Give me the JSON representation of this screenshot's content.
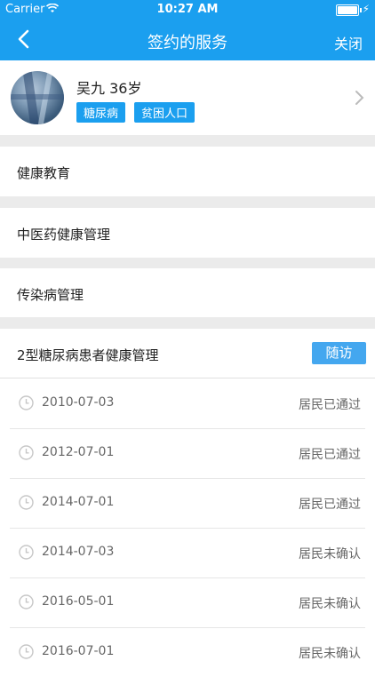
{
  "status_bar": {
    "carrier": "Carrier",
    "time": "10:27 AM"
  },
  "nav": {
    "title": "签约的服务",
    "close_label": "关闭"
  },
  "profile": {
    "name_age": "吴九 36岁",
    "tags": [
      "糖尿病",
      "贫困人口"
    ]
  },
  "menu": [
    "健康教育",
    "中医药健康管理",
    "传染病管理"
  ],
  "diabetes_section": {
    "title": "2型糖尿病患者健康管理",
    "follow_up_label": "随访"
  },
  "records": [
    {
      "date": "2010-07-03",
      "status": "居民已通过"
    },
    {
      "date": "2012-07-01",
      "status": "居民已通过"
    },
    {
      "date": "2014-07-01",
      "status": "居民已通过"
    },
    {
      "date": "2014-07-03",
      "status": "居民未确认"
    },
    {
      "date": "2016-05-01",
      "status": "居民未确认"
    },
    {
      "date": "2016-07-01",
      "status": "居民未确认"
    }
  ],
  "colors": {
    "accent": "#1b9fef",
    "button": "#44a7ef",
    "separator": "#ebebeb"
  }
}
